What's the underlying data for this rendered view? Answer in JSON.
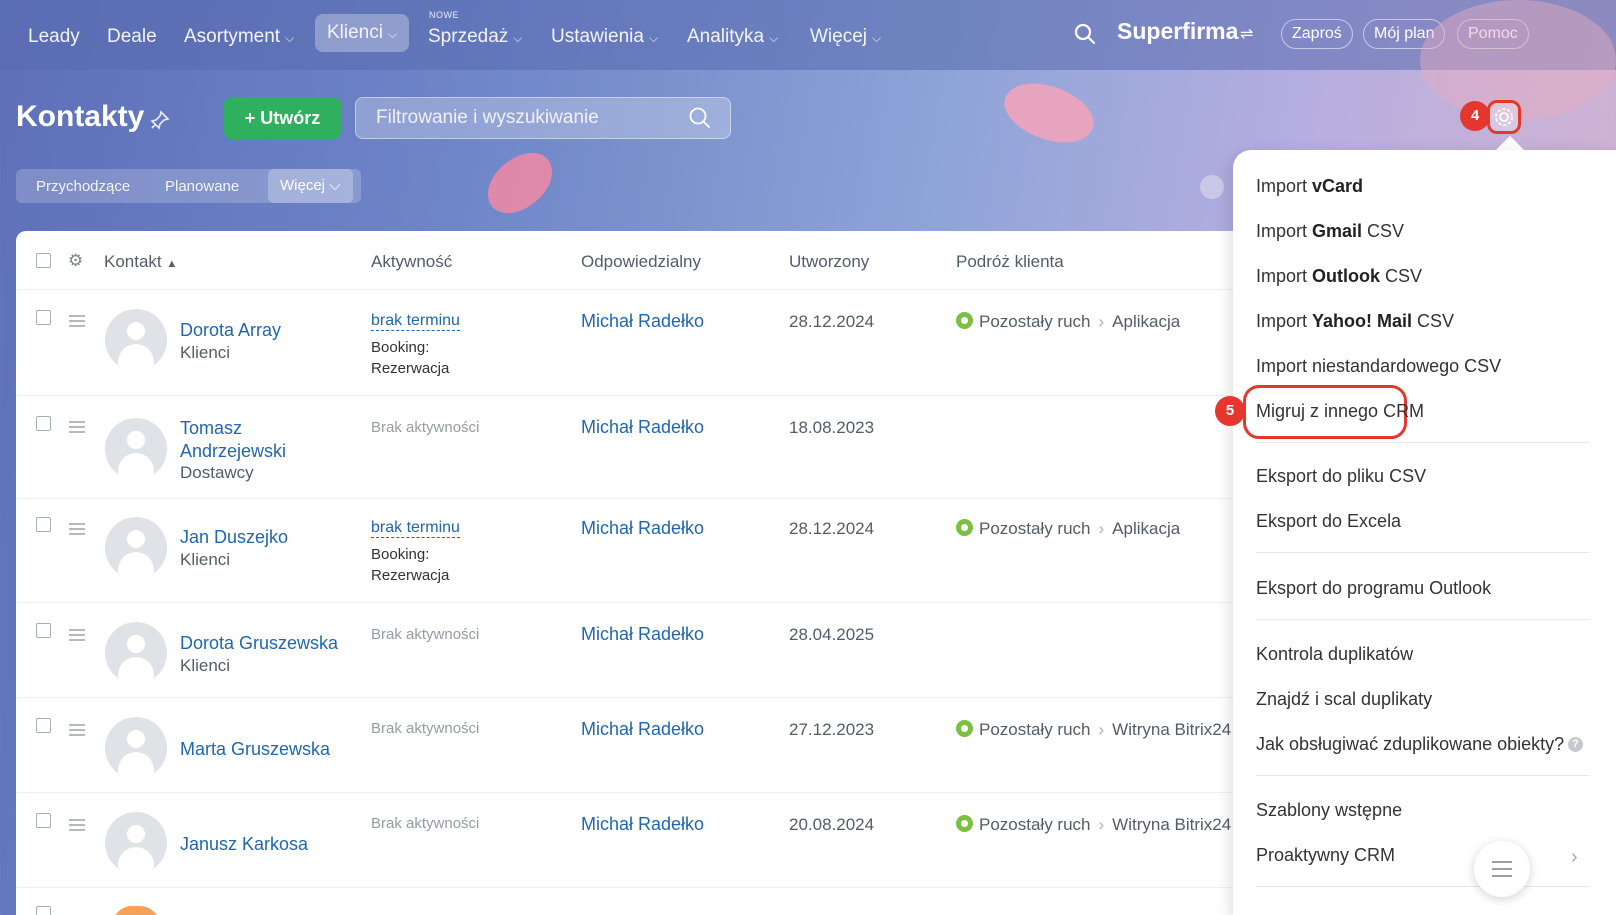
{
  "nav": {
    "items": [
      {
        "label": "Leady"
      },
      {
        "label": "Deale"
      },
      {
        "label": "Asortyment"
      },
      {
        "label": "Klienci"
      },
      {
        "label": "Sprzedaż",
        "badge": "NOWE"
      },
      {
        "label": "Ustawienia"
      },
      {
        "label": "Analityka"
      },
      {
        "label": "Więcej"
      }
    ],
    "brand": "Superfirma",
    "invite": "Zaproś",
    "my_plan": "Mój plan",
    "help": "Pomoc"
  },
  "header": {
    "title": "Kontakty",
    "create_label": "Utwórz",
    "filter_placeholder": "Filtrowanie i wyszukiwanie",
    "counters": [
      "Przychodzące",
      "Planowane"
    ],
    "counters_more": "Więcej",
    "step_gear": "4"
  },
  "table": {
    "headers": {
      "contact": "Kontakt",
      "activity": "Aktywność",
      "responsible": "Odpowiedzialny",
      "created": "Utworzony",
      "journey": "Podróż klienta"
    },
    "rows": [
      {
        "name": "Dorota Array",
        "type": "Klienci",
        "activity_link": "brak terminu",
        "activity_sub1": "Booking:",
        "activity_sub2": "Rezerwacja",
        "responsible": "Michał Radełko",
        "created": "28.12.2024",
        "journey_from": "Pozostały ruch",
        "journey_to": "Aplikacja"
      },
      {
        "name1": "Tomasz",
        "name2": "Andrzejewski",
        "type": "Dostawcy",
        "activity_none": "Brak aktywności",
        "responsible": "Michał Radełko",
        "created": "18.08.2023"
      },
      {
        "name": "Jan Duszejko",
        "type": "Klienci",
        "activity_link": "brak terminu",
        "activity_sub1": "Booking:",
        "activity_sub2": "Rezerwacja",
        "responsible": "Michał Radełko",
        "created": "28.12.2024",
        "journey_from": "Pozostały ruch",
        "journey_to": "Aplikacja"
      },
      {
        "name": "Dorota Gruszewska",
        "type": "Klienci",
        "activity_none": "Brak aktywności",
        "responsible": "Michał Radełko",
        "created": "28.04.2025"
      },
      {
        "name": "Marta Gruszewska",
        "activity_none": "Brak aktywności",
        "responsible": "Michał Radełko",
        "created": "27.12.2023",
        "journey_from": "Pozostały ruch",
        "journey_to": "Witryna Bitrix24"
      },
      {
        "name": "Janusz Karkosa",
        "activity_none": "Brak aktywności",
        "responsible": "Michał Radełko",
        "created": "20.08.2024",
        "journey_from": "Pozostały ruch",
        "journey_to": "Witryna Bitrix24"
      }
    ]
  },
  "menu": {
    "import_vcard_pre": "Import ",
    "import_vcard_bold": "vCard",
    "import_gmail_pre": "Import ",
    "import_gmail_bold": "Gmail",
    "import_gmail_post": " CSV",
    "import_outlook_pre": "Import ",
    "import_outlook_bold": "Outlook",
    "import_outlook_post": " CSV",
    "import_yahoo_pre": "Import ",
    "import_yahoo_bold": "Yahoo! Mail",
    "import_yahoo_post": " CSV",
    "import_custom": "Import niestandardowego CSV",
    "migrate": "Migruj z innego CRM",
    "migrate_step": "5",
    "export_csv": "Eksport do pliku CSV",
    "export_excel": "Eksport do Excela",
    "export_outlook": "Eksport do programu Outlook",
    "dup_control": "Kontrola duplikatów",
    "dup_merge": "Znajdź i scal duplikaty",
    "dup_help": "Jak obsługiwać zduplikowane obiekty?",
    "templates": "Szablony wstępne",
    "proactive": "Proaktywny CRM"
  },
  "colors": {
    "accent_red": "#e4382e",
    "create_green": "#2fb05e",
    "link_blue": "#2067b0"
  }
}
